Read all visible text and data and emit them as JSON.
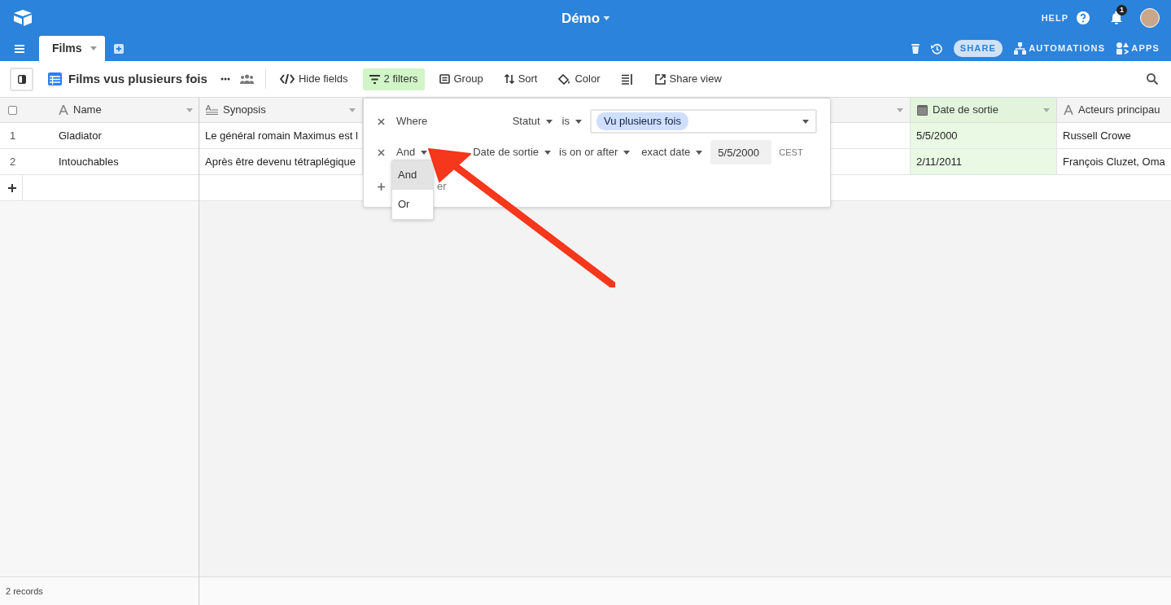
{
  "top_bar": {
    "title": "Démo",
    "help": "HELP",
    "notifications": "1"
  },
  "tables": [
    {
      "label": "Films",
      "selected": true
    }
  ],
  "base_actions": [
    {
      "kind": "share",
      "label": "SHARE"
    },
    {
      "kind": "automations",
      "label": "AUTOMATIONS"
    },
    {
      "kind": "apps",
      "label": "APPS"
    }
  ],
  "view": {
    "name": "Films vus plusieurs fois"
  },
  "toolbar": [
    {
      "kind": "hide",
      "label": "Hide fields",
      "active": false
    },
    {
      "kind": "filter",
      "label": "2 filters",
      "active": true
    },
    {
      "kind": "group",
      "label": "Group",
      "active": false
    },
    {
      "kind": "sort",
      "label": "Sort",
      "active": false
    },
    {
      "kind": "color",
      "label": "Color",
      "active": false
    },
    {
      "kind": "row-height",
      "active": false
    },
    {
      "kind": "share",
      "label": "Share view",
      "active": false
    }
  ],
  "grid": {
    "select_all": {
      "checked": false
    },
    "columns": [
      {
        "kind": "text",
        "label": "Name",
        "filtered": false
      },
      {
        "kind": "long-text",
        "label": "Synopsis",
        "filtered": false
      },
      {
        "kind": "blank",
        "filtered": false
      },
      {
        "kind": "date",
        "label": "Date de sortie",
        "filtered": true
      },
      {
        "kind": "text",
        "label": "Acteurs principau",
        "filtered": false
      }
    ],
    "rows": [
      {
        "number": "1",
        "cells": [
          "Gladiator",
          "Le général romain Maximus est l",
          null,
          "5/5/2000",
          "Russell Crowe"
        ]
      },
      {
        "number": "2",
        "cells": [
          "Intouchables",
          "Après être devenu tétraplégique",
          null,
          "2/11/2011",
          "François Cluzet, Oma"
        ]
      }
    ],
    "footer": "2 records"
  },
  "filter_popup": {
    "conditions": [
      {
        "conjunction": "Where",
        "has_dropdown": false,
        "field": "Statut",
        "operator": "is",
        "kind": "tag",
        "value": "Vu plusieurs fois"
      },
      {
        "conjunction": "And",
        "has_dropdown": true,
        "field": "Date de sortie",
        "operator": "is on or after",
        "mode": "exact date",
        "kind": "date",
        "value": "5/5/2000",
        "timezone": "CEST"
      }
    ],
    "add_filter": "er",
    "conjunction_menu": [
      {
        "label": "And",
        "selected": true
      },
      {
        "label": "Or",
        "selected": false
      }
    ]
  }
}
